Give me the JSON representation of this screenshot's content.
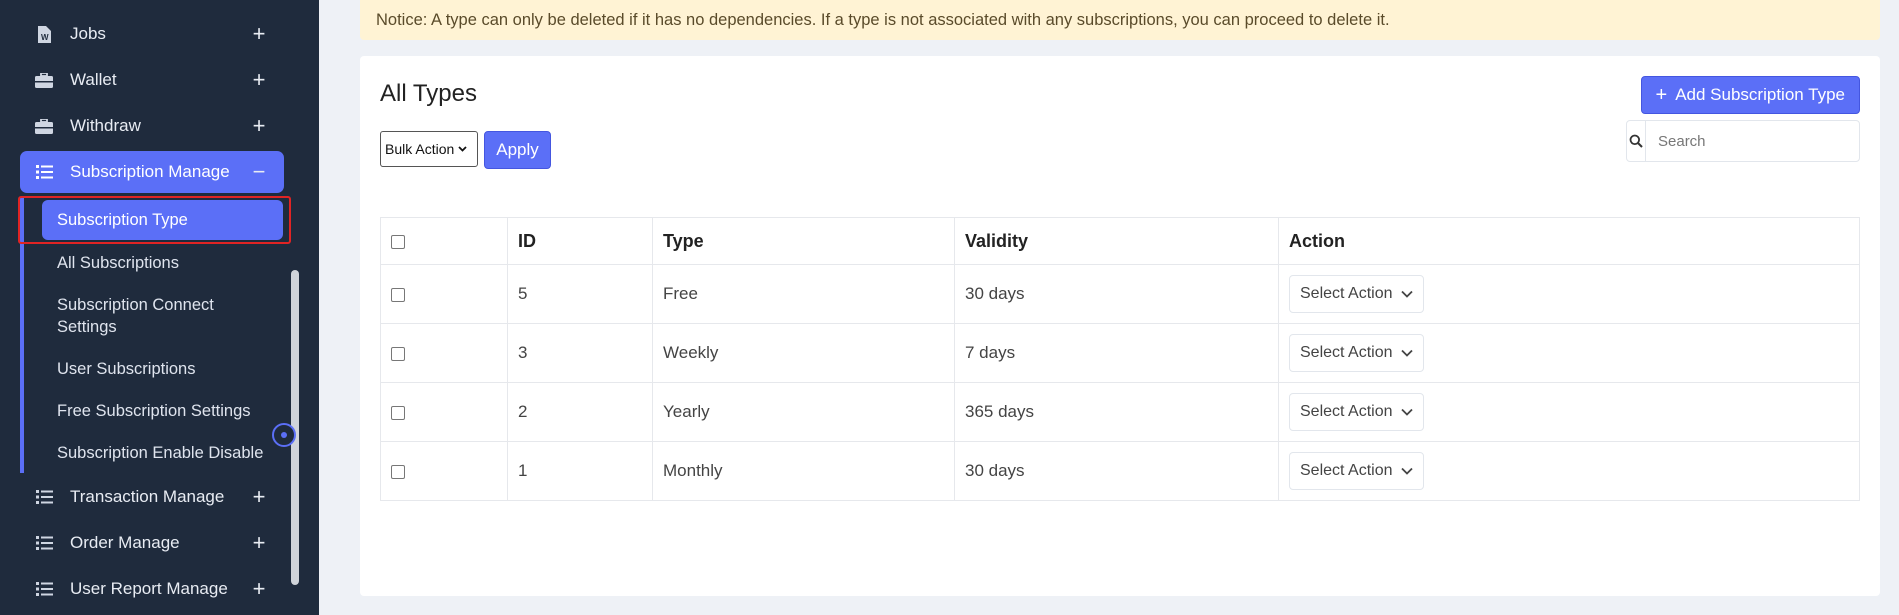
{
  "sidebar": {
    "items": [
      {
        "label": "Jobs",
        "icon": "file-icon",
        "toggle": "+"
      },
      {
        "label": "Wallet",
        "icon": "briefcase-icon",
        "toggle": "+"
      },
      {
        "label": "Withdraw",
        "icon": "briefcase-icon",
        "toggle": "+"
      },
      {
        "label": "Subscription Manage",
        "icon": "list-icon",
        "toggle": "−"
      },
      {
        "label": "Transaction Manage",
        "icon": "list-icon",
        "toggle": "+"
      },
      {
        "label": "Order Manage",
        "icon": "list-icon",
        "toggle": "+"
      },
      {
        "label": "User Report Manage",
        "icon": "list-icon",
        "toggle": "+"
      }
    ],
    "subitems": [
      {
        "label": "Subscription Type"
      },
      {
        "label": "All Subscriptions"
      },
      {
        "label": "Subscription Connect Settings"
      },
      {
        "label": "User Subscriptions"
      },
      {
        "label": "Free Subscription Settings"
      },
      {
        "label": "Subscription Enable Disable"
      }
    ]
  },
  "notice": "Notice: A type can only be deleted if it has no dependencies. If a type is not associated with any subscriptions, you can proceed to delete it.",
  "main": {
    "title": "All Types",
    "add_button": "Add Subscription Type",
    "bulk_action": "Bulk Action",
    "apply": "Apply",
    "search_placeholder": "Search"
  },
  "table": {
    "headers": [
      "ID",
      "Type",
      "Validity",
      "Action"
    ],
    "rows": [
      {
        "id": "5",
        "type": "Free",
        "validity": "30 days",
        "action": "Select Action"
      },
      {
        "id": "3",
        "type": "Weekly",
        "validity": "7 days",
        "action": "Select Action"
      },
      {
        "id": "2",
        "type": "Yearly",
        "validity": "365 days",
        "action": "Select Action"
      },
      {
        "id": "1",
        "type": "Monthly",
        "validity": "30 days",
        "action": "Select Action"
      }
    ]
  },
  "colors": {
    "accent": "#5b6ff7",
    "sidebar_bg": "#1f2b3d",
    "notice_bg": "#fff3d4"
  }
}
